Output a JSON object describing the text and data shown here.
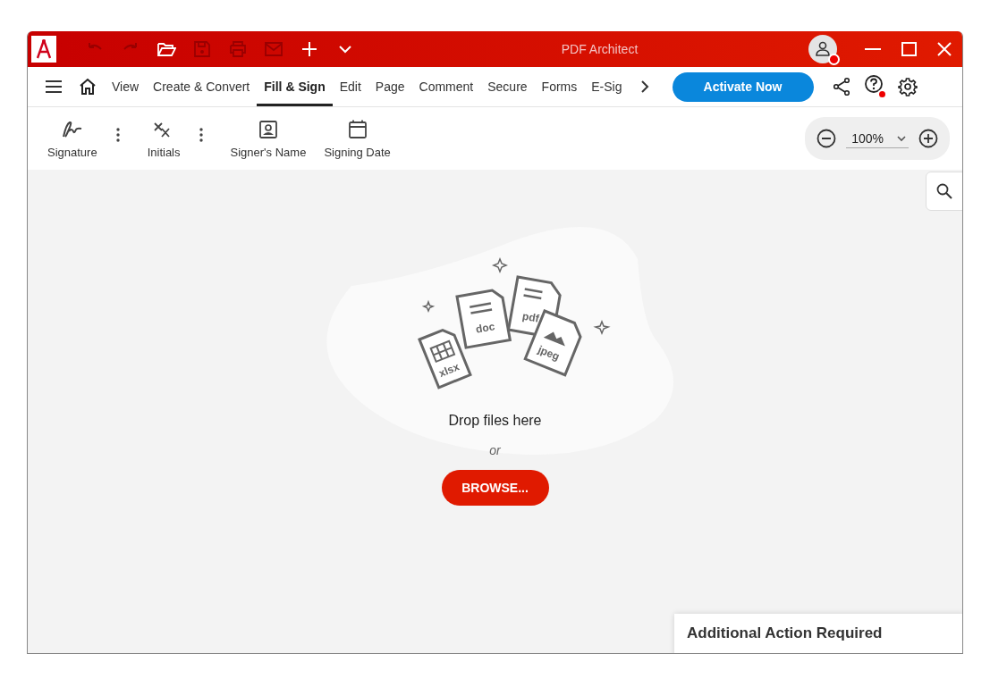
{
  "window": {
    "title": "PDF Architect"
  },
  "quick_actions": [
    {
      "kind": "undo",
      "disabled": true
    },
    {
      "kind": "redo",
      "disabled": true
    },
    {
      "kind": "open",
      "disabled": false
    },
    {
      "kind": "save",
      "disabled": true
    },
    {
      "kind": "print",
      "disabled": true
    },
    {
      "kind": "email",
      "disabled": true
    },
    {
      "kind": "new",
      "disabled": false
    },
    {
      "kind": "more",
      "disabled": false
    }
  ],
  "account": {
    "notification": true
  },
  "tabs": [
    {
      "label": "View",
      "selected": false
    },
    {
      "label": "Create & Convert",
      "selected": false
    },
    {
      "label": "Fill & Sign",
      "selected": true
    },
    {
      "label": "Edit",
      "selected": false
    },
    {
      "label": "Page",
      "selected": false
    },
    {
      "label": "Comment",
      "selected": false
    },
    {
      "label": "Secure",
      "selected": false
    },
    {
      "label": "Forms",
      "selected": false
    },
    {
      "label": "E-Sig",
      "selected": false
    }
  ],
  "activate_button": "Activate Now",
  "help": {
    "notification": true
  },
  "tools": [
    {
      "kind": "signature",
      "label": "Signature",
      "has_menu": true
    },
    {
      "kind": "initials",
      "label": "Initials",
      "has_menu": true
    },
    {
      "kind": "name",
      "label": "Signer's Name",
      "has_menu": false
    },
    {
      "kind": "date",
      "label": "Signing Date",
      "has_menu": false
    }
  ],
  "zoom": {
    "value": "100%"
  },
  "drop_zone": {
    "file_labels": [
      "xlsx",
      "doc",
      "pdf",
      "jpeg"
    ],
    "title": "Drop files here",
    "separator": "or",
    "button": "BROWSE..."
  },
  "toast": {
    "title": "Additional Action Required"
  }
}
